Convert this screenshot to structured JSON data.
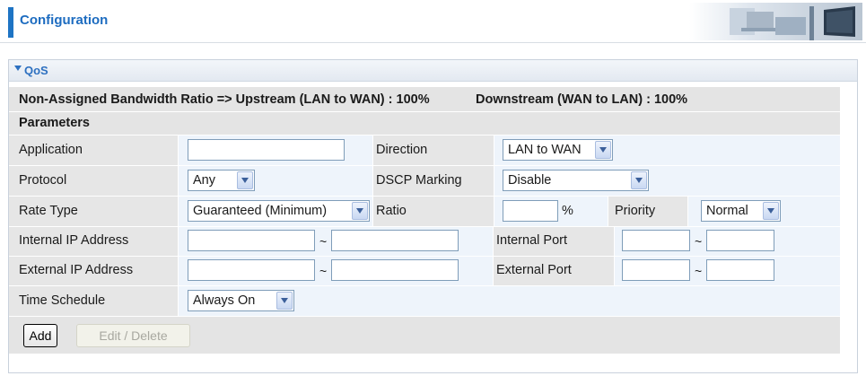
{
  "header": {
    "title": "Configuration"
  },
  "section": {
    "title": "QoS"
  },
  "bandwidth": {
    "text": "Non-Assigned Bandwidth Ratio => Upstream (LAN to WAN) : 100%",
    "downstream": "Downstream (WAN to LAN) : 100%"
  },
  "parameters": {
    "title": "Parameters"
  },
  "form": {
    "application": {
      "label": "Application",
      "value": ""
    },
    "direction": {
      "label": "Direction",
      "value": "LAN to WAN"
    },
    "protocol": {
      "label": "Protocol",
      "value": "Any"
    },
    "dscp_marking": {
      "label": "DSCP Marking",
      "value": "Disable"
    },
    "rate_type": {
      "label": "Rate Type",
      "value": "Guaranteed (Minimum)"
    },
    "ratio": {
      "label": "Ratio",
      "value": "",
      "unit": "%"
    },
    "priority": {
      "label": "Priority",
      "value": "Normal"
    },
    "internal_ip": {
      "label": "Internal IP Address",
      "start": "",
      "end": "",
      "separator": "~"
    },
    "internal_port": {
      "label": "Internal Port",
      "start": "",
      "end": "",
      "separator": "~"
    },
    "external_ip": {
      "label": "External IP Address",
      "start": "",
      "end": "",
      "separator": "~"
    },
    "external_port": {
      "label": "External Port",
      "start": "",
      "end": "",
      "separator": "~"
    },
    "time_schedule": {
      "label": "Time Schedule",
      "value": "Always On"
    }
  },
  "buttons": {
    "add": "Add",
    "edit_delete": "Edit / Delete"
  },
  "colors": {
    "accent": "#1e74c4",
    "title_text": "#1d6cc0",
    "row_grey": "#e6e6e6",
    "row_light": "#eef4fb"
  }
}
